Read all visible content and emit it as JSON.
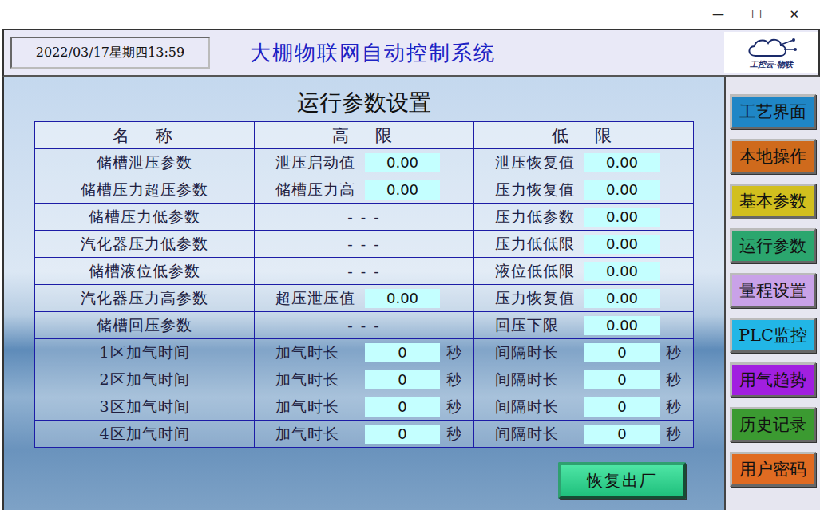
{
  "window": {
    "controls": [
      "—",
      "☐",
      "✕"
    ]
  },
  "header": {
    "datetime": "2022/03/17星期四13:59",
    "title": "大棚物联网自动控制系统",
    "logo_text": "工控云·物联"
  },
  "page_title": "运行参数设置",
  "table": {
    "columns": [
      "名　称",
      "高　限",
      "低　限"
    ],
    "rows": [
      {
        "name": "储槽泄压参数",
        "high": {
          "kind": "field",
          "label": "泄压启动值",
          "value": "0.00"
        },
        "low": {
          "kind": "field",
          "label": "泄压恢复值",
          "value": "0.00"
        }
      },
      {
        "name": "储槽压力超压参数",
        "high": {
          "kind": "field",
          "label": "储槽压力高",
          "value": "0.00"
        },
        "low": {
          "kind": "field",
          "label": "压力恢复值",
          "value": "0.00"
        }
      },
      {
        "name": "储槽压力低参数",
        "high": {
          "kind": "dash",
          "text": "- - -"
        },
        "low": {
          "kind": "field",
          "label": "压力低参数",
          "value": "0.00"
        }
      },
      {
        "name": "汽化器压力低参数",
        "high": {
          "kind": "dash",
          "text": "- - -"
        },
        "low": {
          "kind": "field",
          "label": "压力低低限",
          "value": "0.00"
        }
      },
      {
        "name": "储槽液位低参数",
        "high": {
          "kind": "dash",
          "text": "- - -"
        },
        "low": {
          "kind": "field",
          "label": "液位低低限",
          "value": "0.00"
        }
      },
      {
        "name": "汽化器压力高参数",
        "high": {
          "kind": "field",
          "label": "超压泄压值",
          "value": "0.00"
        },
        "low": {
          "kind": "field",
          "label": "压力恢复值",
          "value": "0.00"
        }
      },
      {
        "name": "储槽回压参数",
        "high": {
          "kind": "dash",
          "text": "- - -"
        },
        "low": {
          "kind": "field",
          "label": "回压下限",
          "value": "0.00"
        }
      },
      {
        "name": "1区加气时间",
        "high": {
          "kind": "field",
          "label": "加气时长",
          "value": "0",
          "unit": "秒"
        },
        "low": {
          "kind": "field",
          "label": "间隔时长",
          "value": "0",
          "unit": "秒"
        }
      },
      {
        "name": "2区加气时间",
        "high": {
          "kind": "field",
          "label": "加气时长",
          "value": "0",
          "unit": "秒"
        },
        "low": {
          "kind": "field",
          "label": "间隔时长",
          "value": "0",
          "unit": "秒"
        }
      },
      {
        "name": "3区加气时间",
        "high": {
          "kind": "field",
          "label": "加气时长",
          "value": "0",
          "unit": "秒"
        },
        "low": {
          "kind": "field",
          "label": "间隔时长",
          "value": "0",
          "unit": "秒"
        }
      },
      {
        "name": "4区加气时间",
        "high": {
          "kind": "field",
          "label": "加气时长",
          "value": "0",
          "unit": "秒"
        },
        "low": {
          "kind": "field",
          "label": "间隔时长",
          "value": "0",
          "unit": "秒"
        }
      }
    ]
  },
  "reset_button": "恢复出厂",
  "sidebar": {
    "items": [
      {
        "label": "工艺界面",
        "color": "#1f86c6"
      },
      {
        "label": "本地操作",
        "color": "#cf6a1c"
      },
      {
        "label": "基本参数",
        "color": "#d2bf1e"
      },
      {
        "label": "运行参数",
        "color": "#2ba66e"
      },
      {
        "label": "量程设置",
        "color": "#c9a2e8"
      },
      {
        "label": "PLC监控",
        "color": "#22b6e6"
      },
      {
        "label": "用气趋势",
        "color": "#a11fe0"
      },
      {
        "label": "历史记录",
        "color": "#3b9a31"
      },
      {
        "label": "用户密码",
        "color": "#e06b22"
      }
    ]
  }
}
